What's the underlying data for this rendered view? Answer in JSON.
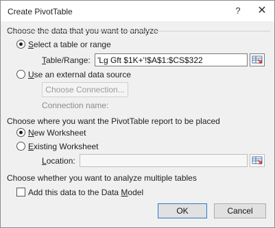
{
  "window": {
    "title": "Create PivotTable",
    "help_label": "?",
    "close_label": "✕"
  },
  "section1": {
    "heading": "Choose the data that you want to analyze",
    "option_select_range": {
      "label_pre": "",
      "label_u": "S",
      "label_post": "elect a table or range",
      "checked": true
    },
    "table_range": {
      "label_pre": "",
      "label_u": "T",
      "label_post": "able/Range:",
      "value": "'Lg Gft $1K+'!$A$1:$CS$322"
    },
    "option_external": {
      "label_pre": "",
      "label_u": "U",
      "label_post": "se an external data source",
      "checked": false
    },
    "choose_connection_label": "Choose Connection...",
    "connection_name_label": "Connection name:"
  },
  "section2": {
    "heading": "Choose where you want the PivotTable report to be placed",
    "option_new": {
      "label_pre": "",
      "label_u": "N",
      "label_post": "ew Worksheet",
      "checked": true
    },
    "option_existing": {
      "label_pre": "",
      "label_u": "E",
      "label_post": "xisting Worksheet",
      "checked": false
    },
    "location": {
      "label_pre": "",
      "label_u": "L",
      "label_post": "ocation:",
      "value": ""
    }
  },
  "section3": {
    "heading": "Choose whether you want to analyze multiple tables",
    "add_data_model": {
      "label_pre": "Add this data to the Data ",
      "label_u": "M",
      "label_post": "odel",
      "checked": false
    }
  },
  "buttons": {
    "ok": "OK",
    "cancel": "Cancel"
  },
  "colors": {
    "default_button_border": "#2b78d3",
    "dialog_background": "#f0f0f0"
  },
  "icons": {
    "range_selector": "collapse-dialog-icon"
  }
}
